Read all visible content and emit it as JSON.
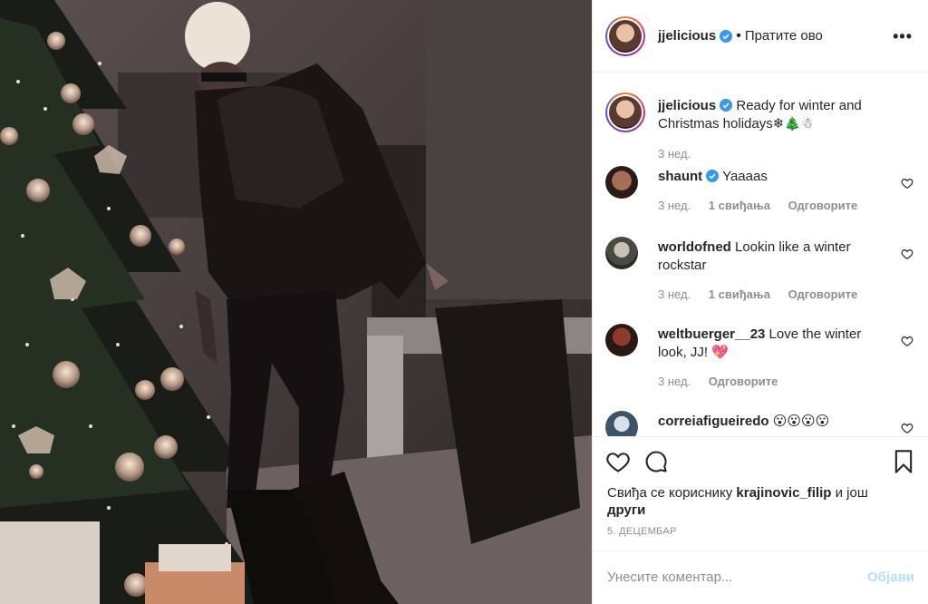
{
  "post": {
    "image_description_icon": "photo-icon"
  },
  "header": {
    "username": "jjelicious",
    "separator": "•",
    "follow_label": "Пратите ово",
    "more_label": "•••"
  },
  "caption": {
    "username": "jjelicious",
    "text": " Ready for winter and Christmas holidays❄🎄☃",
    "age": "3 нед."
  },
  "comments": [
    {
      "username": "shaunt",
      "text": " Yaaaas",
      "age": "3 нед.",
      "likes": "1 свиђања",
      "reply": "Одговорите",
      "verified": true
    },
    {
      "username": "worldofned",
      "text": " Lookin like a winter rockstar",
      "age": "3 нед.",
      "likes": "1 свиђања",
      "reply": "Одговорите",
      "verified": false
    },
    {
      "username": "weltbuerger__23",
      "text": " Love the winter look, JJ! 💖",
      "age": "3 нед.",
      "likes": "",
      "reply": "Одговорите",
      "verified": false
    },
    {
      "username": "correiafigueiredo",
      "text": " 😮😮😮😮",
      "age": "",
      "likes": "",
      "reply": "",
      "verified": false
    }
  ],
  "actions": {
    "likes_prefix": "Свиђа се кориснику ",
    "likes_user": "krajinovic_filip",
    "likes_suffix": " и још",
    "likes_more": "други",
    "date": "5. ДЕЦЕМБАР"
  },
  "compose": {
    "placeholder": "Унесите коментар...",
    "post_label": "Објави"
  },
  "colors": {
    "verified": "#3897f0",
    "link": "#b2dffc",
    "muted": "#8e8e8e"
  }
}
